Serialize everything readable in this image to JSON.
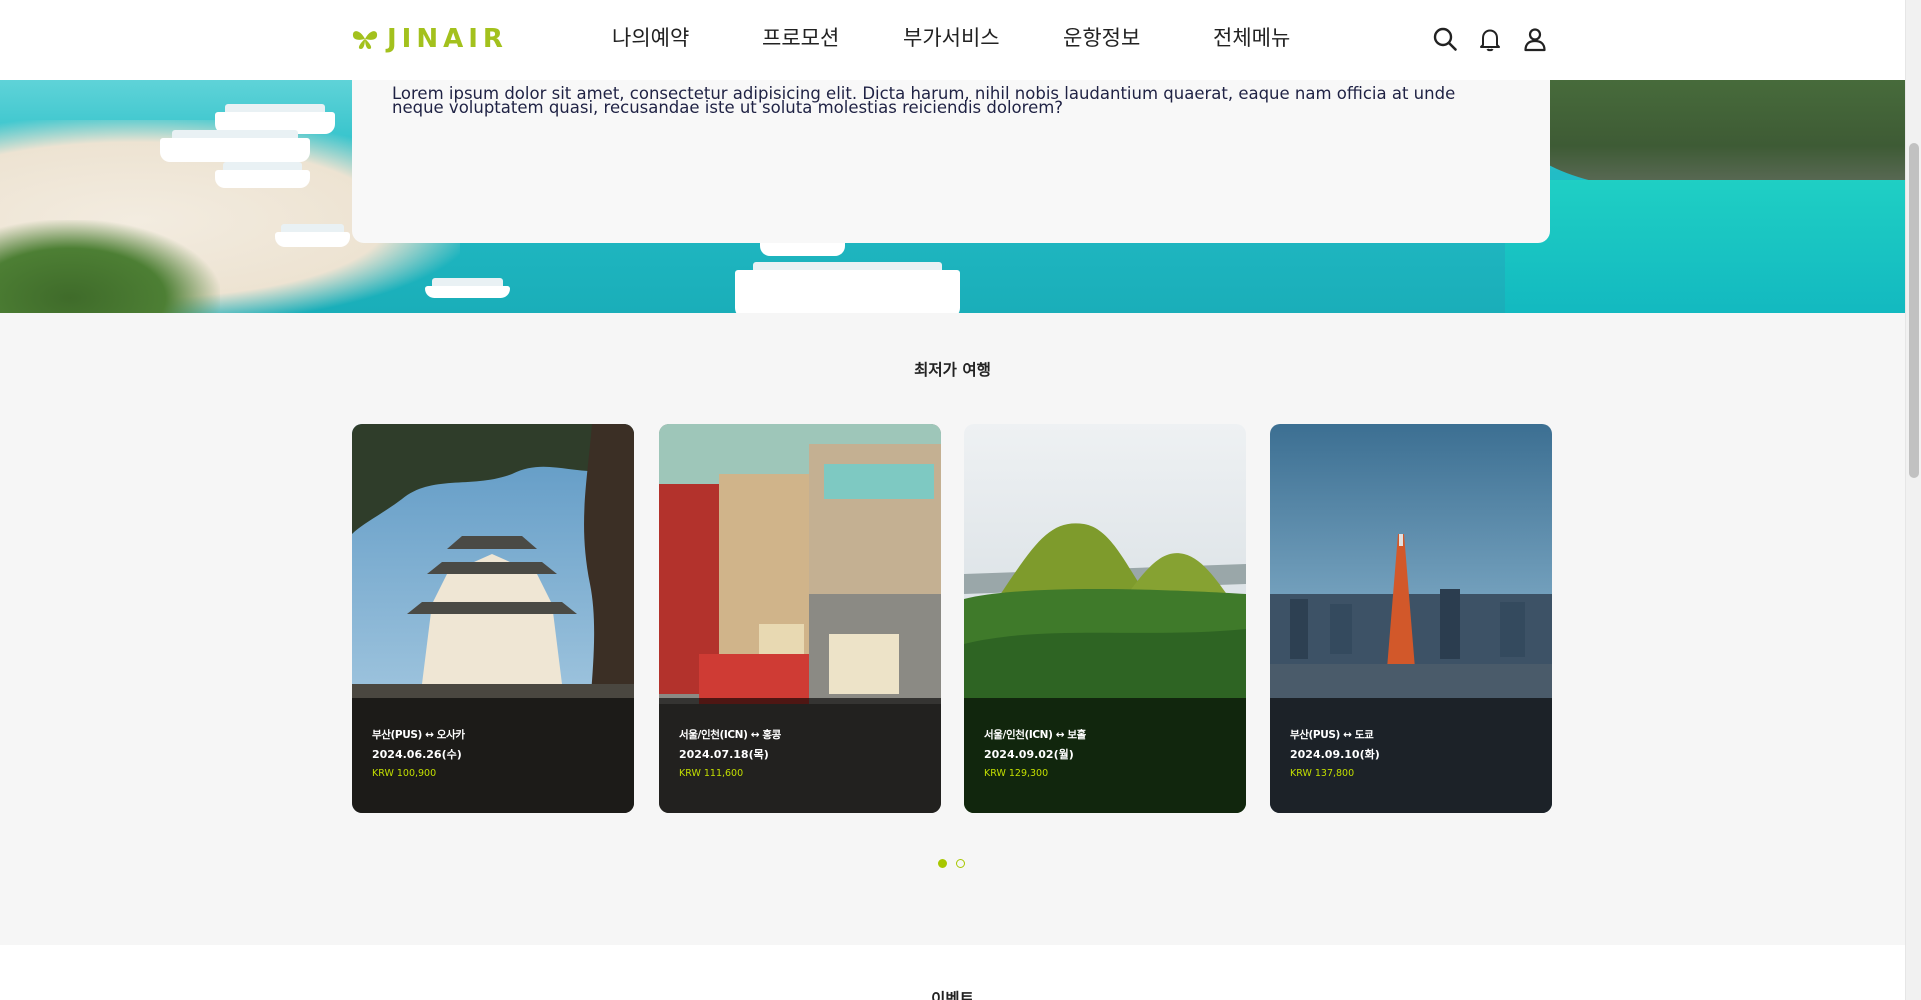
{
  "brand": {
    "name": "JINAIR",
    "accent": "#a3c11d"
  },
  "nav": {
    "items": [
      "나의예약",
      "프로모션",
      "부가서비스",
      "운항정보",
      "전체메뉴"
    ]
  },
  "header_icons": [
    "search-icon",
    "bell-icon",
    "user-icon"
  ],
  "hero": {
    "text": "Lorem ipsum dolor sit amet, consectetur adipisicing elit. Dicta harum, nihil nobis laudantium quaerat, eaque nam officia at unde neque voluptatem quasi, recusandae iste ut soluta molestias reiciendis dolorem?"
  },
  "lowest_fare": {
    "title": "최저가 여행",
    "cards": [
      {
        "route": "부산(PUS) ↔ 오사카",
        "date": "2024.06.26(수)",
        "price": "KRW 100,900",
        "scene": "osaka-castle"
      },
      {
        "route": "서울/인천(ICN) ↔ 홍콩",
        "date": "2024.07.18(목)",
        "price": "KRW 111,600",
        "scene": "hong-kong-street"
      },
      {
        "route": "서울/인천(ICN) ↔ 보홀",
        "date": "2024.09.02(월)",
        "price": "KRW 129,300",
        "scene": "chocolate-hills"
      },
      {
        "route": "부산(PUS) ↔ 도쿄",
        "date": "2024.09.10(화)",
        "price": "KRW 137,800",
        "scene": "tokyo-tower"
      }
    ]
  },
  "pagination": {
    "count": 2,
    "active": 1
  },
  "events": {
    "title": "이벤트"
  }
}
